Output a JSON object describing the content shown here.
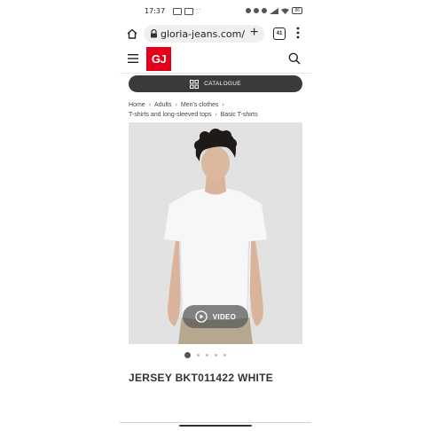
{
  "status_bar": {
    "time": "17:37",
    "more": "···",
    "battery": "86"
  },
  "browser": {
    "url": "gloria-jeans.com/",
    "tab_count": "41"
  },
  "header": {
    "logo_text": "GJ"
  },
  "catalogue": {
    "label": "CATALOGUE"
  },
  "breadcrumbs": [
    "Home",
    "Adults",
    "Men's clothes",
    "T-shirts and long-sleeved tops",
    "Basic T-shirts"
  ],
  "product": {
    "video_label": "VIDEO",
    "title": "JERSEY BKT011422 WHITE",
    "image_count": 5,
    "active_image": 1
  },
  "colors": {
    "brand": "#e3001b",
    "catalogue_bg": "#3a3a3a",
    "image_bg": "#e2e2e2"
  }
}
